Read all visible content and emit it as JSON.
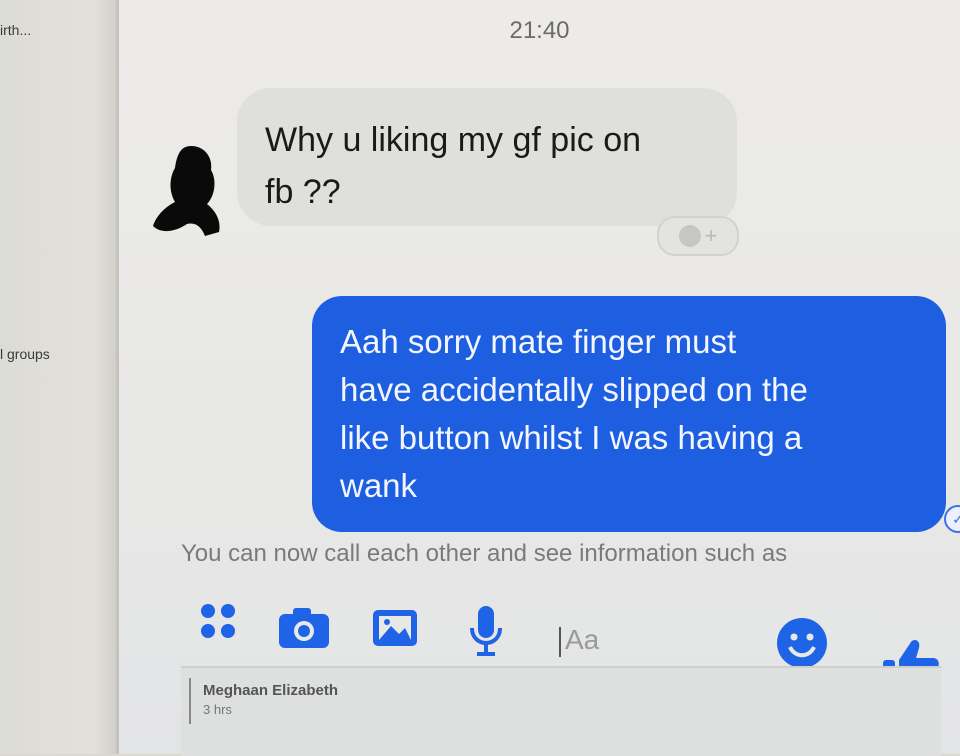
{
  "sidebar": {
    "items": [
      "irth...",
      "l groups"
    ]
  },
  "chat": {
    "timestamp": "21:40",
    "incoming": {
      "line1": "Why u liking my gf pic on",
      "line2": "fb ??"
    },
    "outgoing": {
      "lines": [
        "Aah sorry mate finger must",
        "have accidentally slipped on the",
        "like button whilst I was having a",
        "wank"
      ]
    },
    "info_text": "You can now call each other and see information such as"
  },
  "composer": {
    "placeholder": "Aa",
    "tools": [
      "more-icon",
      "camera-icon",
      "gallery-icon",
      "mic-icon",
      "emoji-icon",
      "thumbs-up-icon"
    ]
  },
  "notification": {
    "name": "Meghaan Elizabeth",
    "time": "3 hrs"
  },
  "colors": {
    "accent": "#1f64e6",
    "outgoing_bubble": "#1d5fe0",
    "incoming_bubble": "#dfdfdc"
  }
}
